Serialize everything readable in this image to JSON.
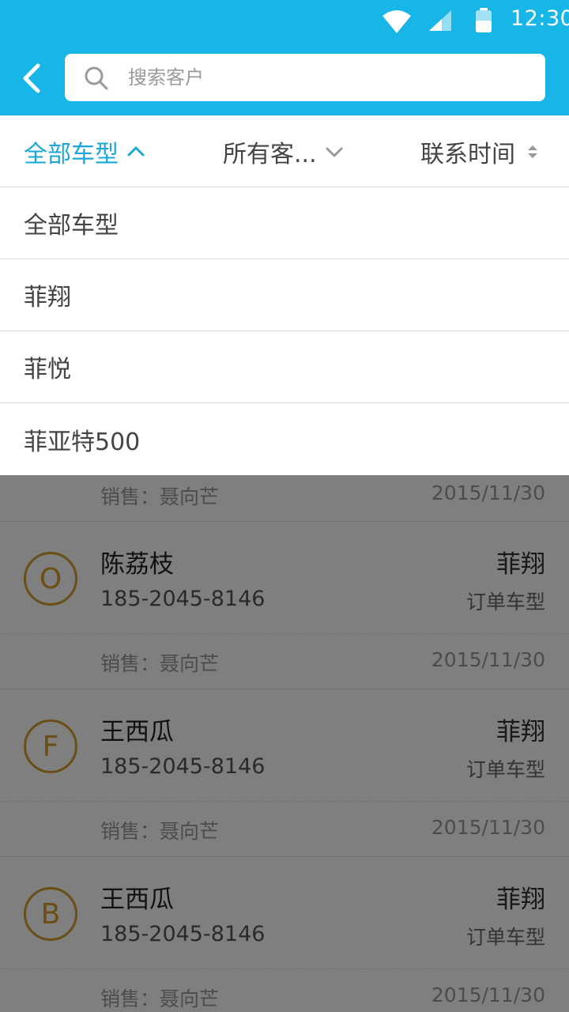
{
  "status_bar": {
    "time": "12:30"
  },
  "search": {
    "placeholder": "搜索客户"
  },
  "filters": {
    "car_type": "全部车型",
    "customers": "所有客...",
    "contact_time": "联系时间"
  },
  "dropdown": {
    "items": [
      {
        "label": "全部车型"
      },
      {
        "label": "菲翔"
      },
      {
        "label": "菲悦"
      },
      {
        "label": "菲亚特500"
      }
    ]
  },
  "list": {
    "top_row": {
      "sales": "销售：聂向芒",
      "date": "2015/11/30"
    },
    "customers": [
      {
        "initial": "O",
        "name": "陈荔枝",
        "phone": "185-2045-8146",
        "model": "菲翔",
        "model_label": "订单车型",
        "sales": "销售：聂向芒",
        "date": "2015/11/30"
      },
      {
        "initial": "F",
        "name": "王西瓜",
        "phone": "185-2045-8146",
        "model": "菲翔",
        "model_label": "订单车型",
        "sales": "销售：聂向芒",
        "date": "2015/11/30"
      },
      {
        "initial": "B",
        "name": "王西瓜",
        "phone": "185-2045-8146",
        "model": "菲翔",
        "model_label": "订单车型",
        "sales": "销售：聂向芒",
        "date": "2015/11/30"
      }
    ]
  },
  "colors": {
    "header": "#17b6e6",
    "accent": "#1aa7d8",
    "avatar": "#d69b2c"
  }
}
